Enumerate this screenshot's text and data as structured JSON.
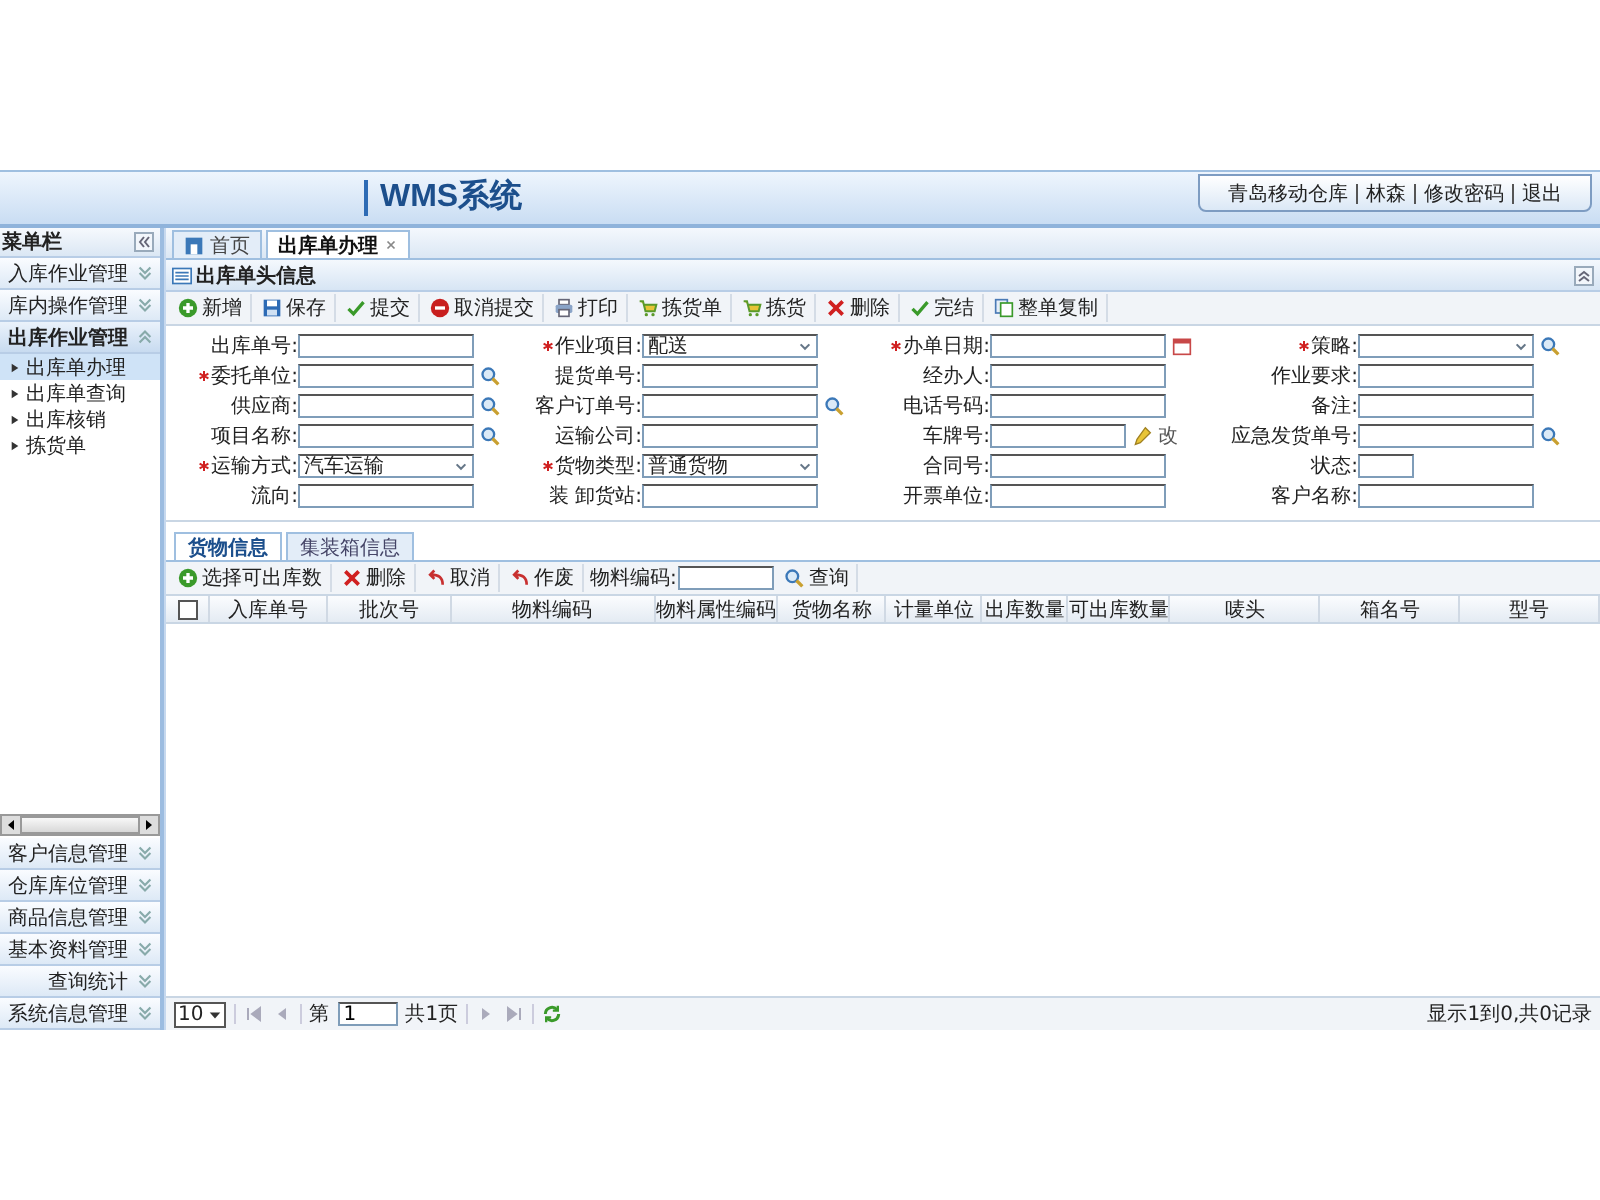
{
  "header": {
    "title": "WMS系统",
    "user_links": [
      "青岛移动仓库",
      "林森",
      "修改密码",
      "退出"
    ]
  },
  "sidebar": {
    "title": "菜单栏",
    "groups": [
      {
        "label": "入库作业管理",
        "expanded": false
      },
      {
        "label": "库内操作管理",
        "expanded": false
      },
      {
        "label": "出库作业管理",
        "expanded": true,
        "items": [
          {
            "label": "出库单办理",
            "selected": true
          },
          {
            "label": "出库单查询",
            "selected": false
          },
          {
            "label": "出库核销",
            "selected": false
          },
          {
            "label": "拣货单",
            "selected": false
          }
        ]
      },
      {
        "label": "客户信息管理",
        "expanded": false
      },
      {
        "label": "仓库库位管理",
        "expanded": false
      },
      {
        "label": "商品信息管理",
        "expanded": false
      },
      {
        "label": "基本资料管理",
        "expanded": false
      },
      {
        "label": "查询统计",
        "expanded": false
      },
      {
        "label": "系统信息管理",
        "expanded": false
      }
    ]
  },
  "tabs": [
    {
      "label": "首页",
      "kind": "home",
      "selected": false
    },
    {
      "label": "出库单办理",
      "kind": "closable",
      "selected": true
    }
  ],
  "panel": {
    "title": "出库单头信息"
  },
  "toolbar": [
    {
      "label": "新增",
      "kind": "add"
    },
    {
      "label": "保存",
      "kind": "save"
    },
    {
      "label": "提交",
      "kind": "check"
    },
    {
      "label": "取消提交",
      "kind": "cancel"
    },
    {
      "label": "打印",
      "kind": "print"
    },
    {
      "label": "拣货单",
      "kind": "cart"
    },
    {
      "label": "拣货",
      "kind": "cart"
    },
    {
      "label": "删除",
      "kind": "delete"
    },
    {
      "label": "完结",
      "kind": "check"
    },
    {
      "label": "整单复制",
      "kind": "copy"
    }
  ],
  "form": [
    {
      "label": "出库单号:",
      "required": false,
      "kind": "text"
    },
    {
      "label": "作业项目:",
      "required": true,
      "kind": "select",
      "value": "配送"
    },
    {
      "label": "办单日期:",
      "required": true,
      "kind": "date"
    },
    {
      "label": "策略:",
      "required": true,
      "kind": "select",
      "search": true
    },
    {
      "label": "委托单位:",
      "required": true,
      "kind": "text",
      "search": true
    },
    {
      "label": "提货单号:",
      "required": false,
      "kind": "text"
    },
    {
      "label": "经办人:",
      "required": false,
      "kind": "text"
    },
    {
      "label": "作业要求:",
      "required": false,
      "kind": "text"
    },
    {
      "label": "供应商:",
      "required": false,
      "kind": "text",
      "search": true
    },
    {
      "label": "客户订单号:",
      "required": false,
      "kind": "text",
      "search": true
    },
    {
      "label": "电话号码:",
      "required": false,
      "kind": "text"
    },
    {
      "label": "备注:",
      "required": false,
      "kind": "text"
    },
    {
      "label": "项目名称:",
      "required": false,
      "kind": "text",
      "search": true
    },
    {
      "label": "运输公司:",
      "required": false,
      "kind": "text"
    },
    {
      "label": "车牌号:",
      "required": false,
      "kind": "text",
      "action": "改"
    },
    {
      "label": "应急发货单号:",
      "required": false,
      "kind": "text",
      "search": true
    },
    {
      "label": "运输方式:",
      "required": true,
      "kind": "select",
      "value": "汽车运输"
    },
    {
      "label": "货物类型:",
      "required": true,
      "kind": "select",
      "value": "普通货物"
    },
    {
      "label": "合同号:",
      "required": false,
      "kind": "text"
    },
    {
      "label": "状态:",
      "required": false,
      "kind": "short"
    },
    {
      "label": "流向:",
      "required": false,
      "kind": "text"
    },
    {
      "label": "装 卸货站:",
      "required": false,
      "kind": "text"
    },
    {
      "label": "开票单位:",
      "required": false,
      "kind": "text"
    },
    {
      "label": "客户名称:",
      "required": false,
      "kind": "text"
    }
  ],
  "sub_tabs": [
    {
      "label": "货物信息",
      "selected": true
    },
    {
      "label": "集装箱信息",
      "selected": false
    }
  ],
  "sub_toolbar": {
    "buttons": [
      {
        "label": "选择可出库数",
        "kind": "add"
      },
      {
        "label": "删除",
        "kind": "delete"
      },
      {
        "label": "取消",
        "kind": "undo"
      },
      {
        "label": "作废",
        "kind": "undo"
      }
    ],
    "search_label": "物料编码:",
    "search_button": "查询"
  },
  "table": {
    "select_all": {
      "checked": false
    },
    "columns": [
      "入库单号",
      "批次号",
      "物料编码",
      "物料属性编码",
      "货物名称",
      "计量单位",
      "出库数量",
      "可出库数量",
      "唛头",
      "箱名号",
      "型号"
    ]
  },
  "pager": {
    "page_size": "10",
    "page_label": "第",
    "page": "1",
    "total_label": "共1页",
    "summary": "显示1到0,共0记录"
  }
}
